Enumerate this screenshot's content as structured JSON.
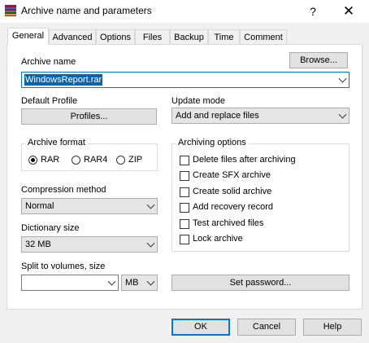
{
  "window": {
    "title": "Archive name and parameters",
    "help_glyph": "?",
    "close_glyph": "✕"
  },
  "tabs": [
    "General",
    "Advanced",
    "Options",
    "Files",
    "Backup",
    "Time",
    "Comment"
  ],
  "archive_name": {
    "label": "Archive name",
    "value": "WindowsReport.rar",
    "browse_label": "Browse..."
  },
  "default_profile": {
    "label": "Default Profile",
    "button_label": "Profiles..."
  },
  "update_mode": {
    "label": "Update mode",
    "value": "Add and replace files"
  },
  "archive_format": {
    "label": "Archive format",
    "options": [
      "RAR",
      "RAR4",
      "ZIP"
    ],
    "selected": "RAR"
  },
  "compression_method": {
    "label": "Compression method",
    "value": "Normal"
  },
  "dictionary_size": {
    "label": "Dictionary size",
    "value": "32 MB"
  },
  "archiving_options": {
    "label": "Archiving options",
    "items": [
      {
        "label": "Delete files after archiving",
        "checked": false
      },
      {
        "label": "Create SFX archive",
        "checked": false
      },
      {
        "label": "Create solid archive",
        "checked": false
      },
      {
        "label": "Add recovery record",
        "checked": false
      },
      {
        "label": "Test archived files",
        "checked": false
      },
      {
        "label": "Lock archive",
        "checked": false
      }
    ]
  },
  "split_volumes": {
    "label": "Split to volumes, size",
    "value": "",
    "unit": "MB"
  },
  "set_password_label": "Set password...",
  "footer": {
    "ok_label": "OK",
    "cancel_label": "Cancel",
    "help_label": "Help"
  },
  "colors": {
    "accent": "#0078d7",
    "selection": "#0a64ad",
    "app_icon": "#8b1a4a"
  }
}
